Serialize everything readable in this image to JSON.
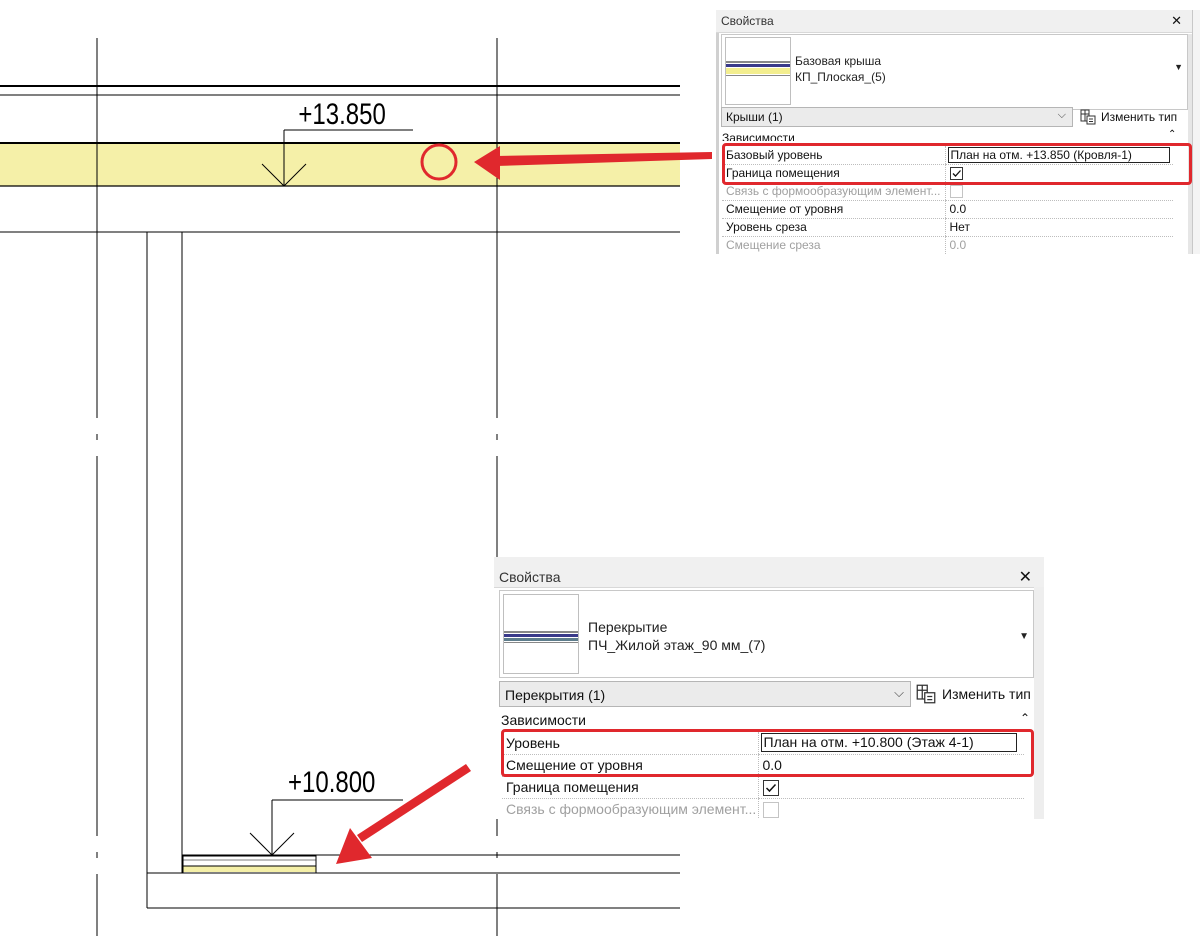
{
  "drawing": {
    "upper_level_mark": "+13.850",
    "lower_level_mark": "+10.800"
  },
  "colors": {
    "roof_fill": "#f5f0a8",
    "annotation_red": "#e0282d"
  },
  "panel_roof": {
    "title": "Свойства",
    "close_label": "✕",
    "family": "Базовая крыша",
    "type": "КП_Плоская_(5)",
    "filter_label": "Крыши (1)",
    "edit_type_label": "Изменить тип",
    "section": "Зависимости",
    "rows": [
      {
        "label": "Базовый уровень",
        "value": "План на отм. +13.850 (Кровля-1)"
      },
      {
        "label": "Граница помещения",
        "checked": true
      },
      {
        "label": "Связь с формообразующим элемент...",
        "checked": false
      },
      {
        "label": "Смещение от уровня",
        "value": "0.0"
      },
      {
        "label": "Уровень среза",
        "value": "Нет"
      },
      {
        "label": "Смещение среза",
        "value": "0.0"
      }
    ]
  },
  "panel_floor": {
    "title": "Свойства",
    "close_label": "✕",
    "family": "Перекрытие",
    "type": "ПЧ_Жилой этаж_90 мм_(7)",
    "filter_label": "Перекрытия (1)",
    "edit_type_label": "Изменить тип",
    "section": "Зависимости",
    "rows": [
      {
        "label": "Уровень",
        "value": "План на отм. +10.800 (Этаж 4-1)"
      },
      {
        "label": "Смещение от уровня",
        "value": "0.0"
      },
      {
        "label": "Граница помещения",
        "checked": true
      },
      {
        "label": "Связь с формообразующим элемент...",
        "checked": false
      }
    ]
  }
}
